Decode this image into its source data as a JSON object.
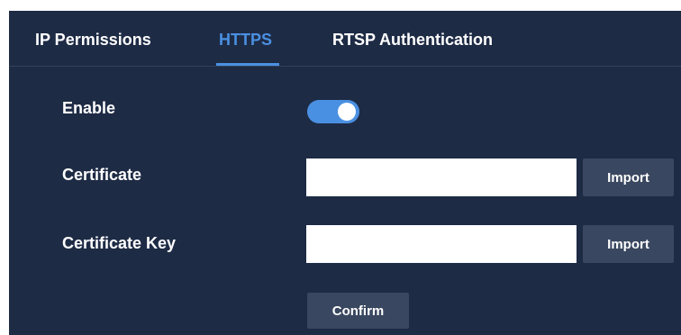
{
  "tabs": [
    {
      "label": "IP Permissions",
      "active": false
    },
    {
      "label": "HTTPS",
      "active": true
    },
    {
      "label": "RTSP Authentication",
      "active": false
    }
  ],
  "form": {
    "enable_label": "Enable",
    "enable_value": true,
    "certificate_label": "Certificate",
    "certificate_value": "",
    "certificate_key_label": "Certificate Key",
    "certificate_key_value": "",
    "import_label": "Import",
    "confirm_label": "Confirm"
  },
  "colors": {
    "panel_bg": "#1e2b45",
    "accent": "#4a90e2",
    "button_bg": "#3a4760",
    "text": "#ffffff"
  },
  "icons": {
    "toggle": "toggle-switch-icon"
  }
}
